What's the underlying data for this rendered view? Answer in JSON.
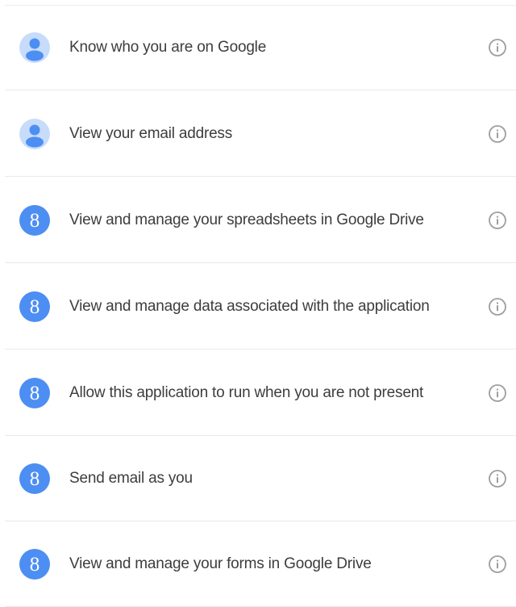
{
  "colors": {
    "account_icon_bg": "#c7dcfb",
    "account_icon_fg": "#4d8ef3",
    "gplus_icon_bg": "#4d8ef3",
    "gplus_icon_fg": "#ffffff",
    "info_icon": "#9e9e9e",
    "text": "#3d3d3d",
    "divider": "#e9e9e9"
  },
  "permissions": [
    {
      "icon": "account-icon",
      "label": "Know who you are on Google",
      "info_icon": "info-icon"
    },
    {
      "icon": "account-icon",
      "label": "View your email address",
      "info_icon": "info-icon"
    },
    {
      "icon": "google-plus-icon",
      "glyph": "8",
      "label": "View and manage your spreadsheets in Google Drive",
      "info_icon": "info-icon"
    },
    {
      "icon": "google-plus-icon",
      "glyph": "8",
      "label": "View and manage data associated with the application",
      "info_icon": "info-icon"
    },
    {
      "icon": "google-plus-icon",
      "glyph": "8",
      "label": "Allow this application to run when you are not present",
      "info_icon": "info-icon"
    },
    {
      "icon": "google-plus-icon",
      "glyph": "8",
      "label": "Send email as you",
      "info_icon": "info-icon"
    },
    {
      "icon": "google-plus-icon",
      "glyph": "8",
      "label": "View and manage your forms in Google Drive",
      "info_icon": "info-icon"
    }
  ]
}
